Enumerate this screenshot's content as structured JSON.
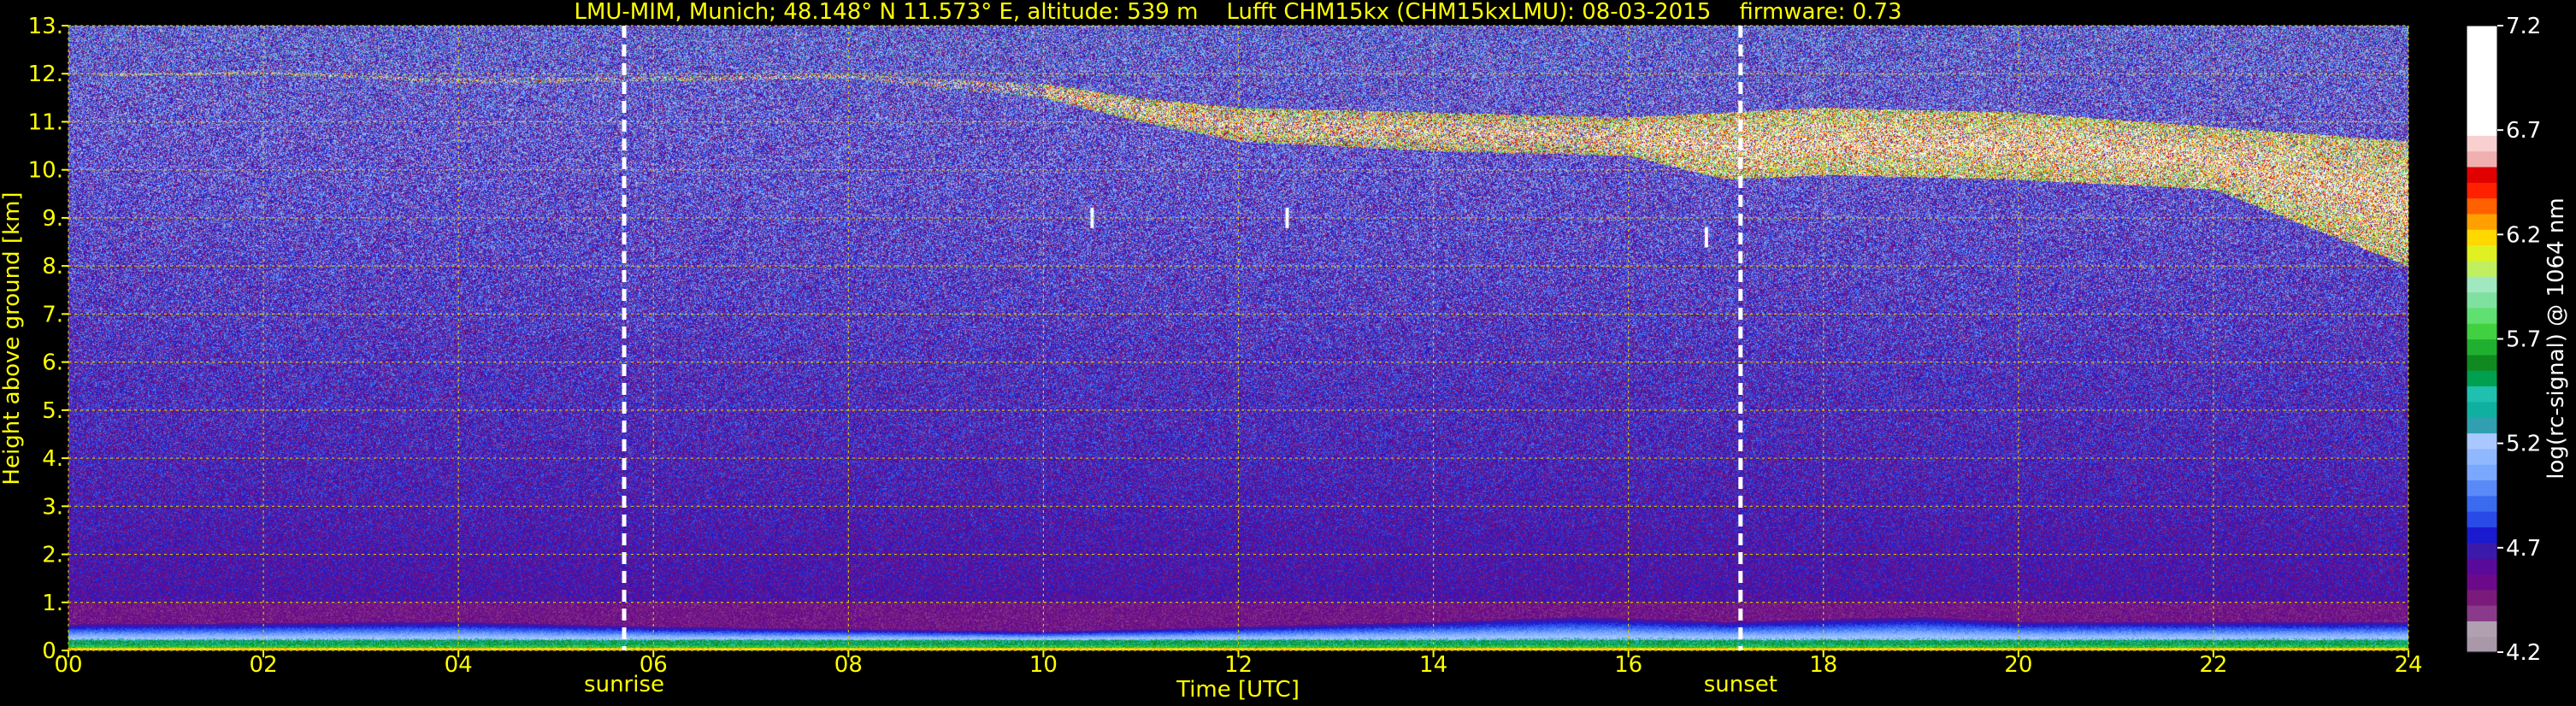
{
  "title": "LMU-MIM, Munich; 48.148° N 11.573° E, altitude: 539 m    Lufft CHM15kx (CHM15kxLMU): 08-03-2015    firmware: 0.73",
  "colors": {
    "text": "#ffff00",
    "background": "#000000",
    "grid": "#d8c800",
    "marker_line": "#ffffff",
    "colorbar_label": "#ffffff"
  },
  "chart_data": {
    "type": "heatmap",
    "title": "LMU-MIM, Munich; 48.148° N 11.573° E, altitude: 539 m    Lufft CHM15kx (CHM15kxLMU): 08-03-2015    firmware: 0.73",
    "xlabel": "Time [UTC]",
    "ylabel": "Height above ground [km]",
    "xlim": [
      0,
      24
    ],
    "ylim": [
      0,
      13
    ],
    "x_ticks": [
      "00",
      "02",
      "04",
      "06",
      "08",
      "10",
      "12",
      "14",
      "16",
      "18",
      "20",
      "22",
      "24"
    ],
    "y_ticks": [
      "0.",
      "1.",
      "2.",
      "3.",
      "4.",
      "5.",
      "6.",
      "7.",
      "8.",
      "9.",
      "10.",
      "11.",
      "12.",
      "13."
    ],
    "grid": true,
    "markers": [
      {
        "label": "sunrise",
        "x": 5.7
      },
      {
        "label": "sunset",
        "x": 17.15
      }
    ],
    "colorbar": {
      "label": "log(rc-signal) @ 1064 nm",
      "range": [
        4.2,
        7.2
      ],
      "ticks": [
        "7.2",
        "6.7",
        "6.2",
        "5.7",
        "5.2",
        "4.7",
        "4.2"
      ],
      "colors": [
        "#a898a8",
        "#b0a0b0",
        "#8a3a8a",
        "#7a1a7a",
        "#6a0a8a",
        "#5a0a9a",
        "#3a1aaa",
        "#1a1ad0",
        "#2a4ae8",
        "#3a6af0",
        "#5a8af8",
        "#7aa8ff",
        "#90b8ff",
        "#a8c8ff",
        "#30a0b0",
        "#10b0a0",
        "#20c0b0",
        "#00a050",
        "#108a20",
        "#20b030",
        "#40d040",
        "#60e070",
        "#80e0a0",
        "#a0e8c0",
        "#c0f060",
        "#e0f020",
        "#ffd800",
        "#ffa000",
        "#ff6000",
        "#ff2000",
        "#e00000",
        "#f0b0b0",
        "#f8d0d0",
        "#ffffff",
        "#ffffff",
        "#ffffff",
        "#ffffff",
        "#ffffff",
        "#ffffff",
        "#ffffff"
      ]
    },
    "features": {
      "cirrus_top_km": [
        [
          0,
          12.0
        ],
        [
          2,
          12.05
        ],
        [
          4,
          11.9
        ],
        [
          6,
          11.95
        ],
        [
          8,
          12.0
        ],
        [
          10,
          11.8
        ],
        [
          11,
          11.5
        ],
        [
          12,
          11.3
        ],
        [
          14,
          11.2
        ],
        [
          16,
          11.1
        ],
        [
          17,
          11.2
        ],
        [
          18,
          11.3
        ],
        [
          20,
          11.2
        ],
        [
          22,
          10.9
        ],
        [
          24,
          10.6
        ]
      ],
      "cirrus_base_km": [
        [
          0,
          11.95
        ],
        [
          2,
          12.0
        ],
        [
          4,
          11.8
        ],
        [
          6,
          11.85
        ],
        [
          8,
          11.9
        ],
        [
          10,
          11.5
        ],
        [
          11,
          11.0
        ],
        [
          12,
          10.6
        ],
        [
          14,
          10.4
        ],
        [
          16,
          10.3
        ],
        [
          17,
          9.8
        ],
        [
          18,
          9.9
        ],
        [
          20,
          9.8
        ],
        [
          22,
          9.6
        ],
        [
          24,
          8.0
        ]
      ],
      "boundary_layer_top_km": [
        [
          0,
          0.55
        ],
        [
          4,
          0.6
        ],
        [
          6,
          0.5
        ],
        [
          10,
          0.4
        ],
        [
          12,
          0.5
        ],
        [
          14,
          0.6
        ],
        [
          15.5,
          0.7
        ],
        [
          17,
          0.6
        ],
        [
          19,
          0.7
        ],
        [
          20,
          0.6
        ],
        [
          24,
          0.6
        ]
      ],
      "fall_streaks": [
        {
          "x": 10.5,
          "y": 9.0
        },
        {
          "x": 12.5,
          "y": 9.0
        },
        {
          "x": 16.8,
          "y": 8.6
        }
      ]
    }
  }
}
